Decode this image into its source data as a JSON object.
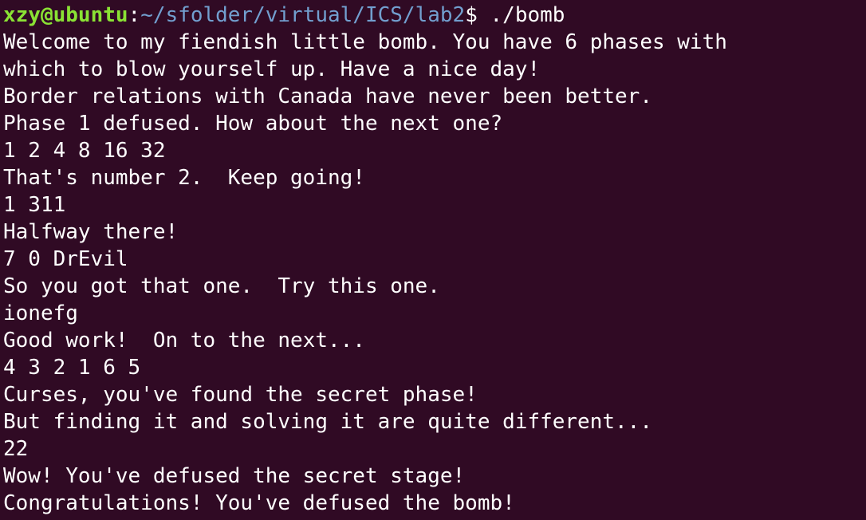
{
  "colors": {
    "background": "#300a24",
    "foreground": "#ffffff",
    "prompt_user_host": "#8ae234",
    "prompt_path": "#729fcf"
  },
  "prompt": {
    "user_host": "xzy@ubuntu",
    "separator": ":",
    "path": "~/sfolder/virtual/ICS/lab2",
    "symbol": "$ ",
    "command": "./bomb"
  },
  "output_lines": [
    "Welcome to my fiendish little bomb. You have 6 phases with",
    "which to blow yourself up. Have a nice day!",
    "Border relations with Canada have never been better.",
    "Phase 1 defused. How about the next one?",
    "1 2 4 8 16 32",
    "That's number 2.  Keep going!",
    "1 311",
    "Halfway there!",
    "7 0 DrEvil",
    "So you got that one.  Try this one.",
    "ionefg",
    "Good work!  On to the next...",
    "4 3 2 1 6 5",
    "Curses, you've found the secret phase!",
    "But finding it and solving it are quite different...",
    "22",
    "Wow! You've defused the secret stage!",
    "Congratulations! You've defused the bomb!"
  ]
}
